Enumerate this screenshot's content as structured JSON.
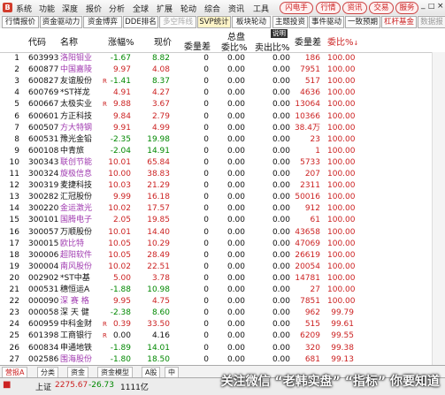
{
  "menubar": {
    "logo": "B",
    "items": [
      "系统",
      "功能",
      "深度",
      "报价",
      "分析",
      "全球",
      "扩展",
      "轮动",
      "综合",
      "资讯",
      "工具"
    ],
    "pills": [
      "闪电手",
      "行情",
      "资讯",
      "交易",
      "服务"
    ],
    "caption_icons": [
      "_",
      "□",
      "×"
    ]
  },
  "tabs": [
    "行情报价",
    "资金驱动力",
    "资金博弈",
    "DDE排名",
    "多空阵线",
    "SVP统计",
    "板块轮动",
    "主题投资",
    "事件驱动",
    "一致预期",
    "杠杆基金",
    "数据报告"
  ],
  "header": {
    "idx": "",
    "code": "代码",
    "name": "名称",
    "pct": "涨幅%",
    "price": "现价",
    "vol": "委量差",
    "total_top": "总盘",
    "ratio": "委比%",
    "sell": "卖出比%",
    "explain": "说明",
    "vol2": "委量差",
    "ratio2": "委比%"
  },
  "rows": [
    {
      "idx": "1",
      "code": "603993",
      "name": "洛阳钼业",
      "mark": "",
      "pct": "-1.67",
      "price": "8.82",
      "vol": "0",
      "ratio": "0.00",
      "sell": "0.00",
      "vol2": "186",
      "ratio2": "100.00",
      "nc": "purple",
      "pc": "green",
      "vc": "red"
    },
    {
      "idx": "2",
      "code": "600877",
      "name": "中国嘉陵",
      "mark": "",
      "pct": "9.97",
      "price": "4.08",
      "vol": "0",
      "ratio": "0.00",
      "sell": "0.00",
      "vol2": "7951",
      "ratio2": "100.00",
      "nc": "purple",
      "pc": "red",
      "vc": "red"
    },
    {
      "idx": "3",
      "code": "600827",
      "name": "友谊股份",
      "mark": "R",
      "pct": "-1.41",
      "price": "8.37",
      "vol": "0",
      "ratio": "0.00",
      "sell": "0.00",
      "vol2": "517",
      "ratio2": "100.00",
      "nc": "dark",
      "pc": "green",
      "vc": "red"
    },
    {
      "idx": "4",
      "code": "600769",
      "name": "*ST祥龙",
      "mark": "",
      "pct": "4.91",
      "price": "4.27",
      "vol": "0",
      "ratio": "0.00",
      "sell": "0.00",
      "vol2": "4636",
      "ratio2": "100.00",
      "nc": "dark",
      "pc": "red",
      "vc": "red"
    },
    {
      "idx": "5",
      "code": "600667",
      "name": "太极实业",
      "mark": "R",
      "pct": "9.88",
      "price": "3.67",
      "vol": "0",
      "ratio": "0.00",
      "sell": "0.00",
      "vol2": "13064",
      "ratio2": "100.00",
      "nc": "dark",
      "pc": "red",
      "vc": "red"
    },
    {
      "idx": "6",
      "code": "600601",
      "name": "方正科技",
      "mark": "",
      "pct": "9.84",
      "price": "2.79",
      "vol": "0",
      "ratio": "0.00",
      "sell": "0.00",
      "vol2": "10366",
      "ratio2": "100.00",
      "nc": "dark",
      "pc": "red",
      "vc": "red"
    },
    {
      "idx": "7",
      "code": "600507",
      "name": "方大特钢",
      "mark": "",
      "pct": "9.91",
      "price": "4.99",
      "vol": "0",
      "ratio": "0.00",
      "sell": "0.00",
      "vol2": "38.4万",
      "ratio2": "100.00",
      "nc": "purple",
      "pc": "red",
      "vc": "red"
    },
    {
      "idx": "8",
      "code": "600531",
      "name": "豫光金铅",
      "mark": "",
      "pct": "-2.35",
      "price": "19.98",
      "vol": "0",
      "ratio": "0.00",
      "sell": "0.00",
      "vol2": "23",
      "ratio2": "100.00",
      "nc": "dark",
      "pc": "green",
      "vc": "red"
    },
    {
      "idx": "9",
      "code": "600108",
      "name": "中青旅",
      "mark": "",
      "pct": "-2.04",
      "price": "14.91",
      "vol": "0",
      "ratio": "0.00",
      "sell": "0.00",
      "vol2": "1",
      "ratio2": "100.00",
      "nc": "dark",
      "pc": "green",
      "vc": "red"
    },
    {
      "idx": "10",
      "code": "300343",
      "name": "联创节能",
      "mark": "",
      "pct": "10.01",
      "price": "65.84",
      "vol": "0",
      "ratio": "0.00",
      "sell": "0.00",
      "vol2": "5733",
      "ratio2": "100.00",
      "nc": "purple",
      "pc": "red",
      "vc": "red"
    },
    {
      "idx": "11",
      "code": "300324",
      "name": "旋极信息",
      "mark": "",
      "pct": "10.00",
      "price": "38.83",
      "vol": "0",
      "ratio": "0.00",
      "sell": "0.00",
      "vol2": "207",
      "ratio2": "100.00",
      "nc": "purple",
      "pc": "red",
      "vc": "red"
    },
    {
      "idx": "12",
      "code": "300319",
      "name": "麦捷科技",
      "mark": "",
      "pct": "10.03",
      "price": "21.29",
      "vol": "0",
      "ratio": "0.00",
      "sell": "0.00",
      "vol2": "2311",
      "ratio2": "100.00",
      "nc": "dark",
      "pc": "red",
      "vc": "red"
    },
    {
      "idx": "13",
      "code": "300282",
      "name": "汇冠股份",
      "mark": "",
      "pct": "9.99",
      "price": "16.18",
      "vol": "0",
      "ratio": "0.00",
      "sell": "0.00",
      "vol2": "50016",
      "ratio2": "100.00",
      "nc": "dark",
      "pc": "red",
      "vc": "red"
    },
    {
      "idx": "14",
      "code": "300220",
      "name": "金运激光",
      "mark": "",
      "pct": "10.02",
      "price": "17.57",
      "vol": "0",
      "ratio": "0.00",
      "sell": "0.00",
      "vol2": "912",
      "ratio2": "100.00",
      "nc": "purple",
      "pc": "red",
      "vc": "red"
    },
    {
      "idx": "15",
      "code": "300101",
      "name": "国腾电子",
      "mark": "",
      "pct": "2.05",
      "price": "19.85",
      "vol": "0",
      "ratio": "0.00",
      "sell": "0.00",
      "vol2": "61",
      "ratio2": "100.00",
      "nc": "purple",
      "pc": "red",
      "vc": "red"
    },
    {
      "idx": "16",
      "code": "300057",
      "name": "万顺股份",
      "mark": "",
      "pct": "10.01",
      "price": "14.40",
      "vol": "0",
      "ratio": "0.00",
      "sell": "0.00",
      "vol2": "43658",
      "ratio2": "100.00",
      "nc": "dark",
      "pc": "red",
      "vc": "red"
    },
    {
      "idx": "17",
      "code": "300015",
      "name": "欧比特",
      "mark": "",
      "pct": "10.05",
      "price": "10.29",
      "vol": "0",
      "ratio": "0.00",
      "sell": "0.00",
      "vol2": "47069",
      "ratio2": "100.00",
      "nc": "purple",
      "pc": "red",
      "vc": "red"
    },
    {
      "idx": "18",
      "code": "300006",
      "name": "超阳软件",
      "mark": "",
      "pct": "10.05",
      "price": "28.49",
      "vol": "0",
      "ratio": "0.00",
      "sell": "0.00",
      "vol2": "26619",
      "ratio2": "100.00",
      "nc": "purple",
      "pc": "red",
      "vc": "red"
    },
    {
      "idx": "19",
      "code": "300004",
      "name": "南风股份",
      "mark": "",
      "pct": "10.02",
      "price": "22.51",
      "vol": "0",
      "ratio": "0.00",
      "sell": "0.00",
      "vol2": "20054",
      "ratio2": "100.00",
      "nc": "purple",
      "pc": "red",
      "vc": "red"
    },
    {
      "idx": "20",
      "code": "002902",
      "name": "*ST中基",
      "mark": "",
      "pct": "5.00",
      "price": "3.78",
      "vol": "0",
      "ratio": "0.00",
      "sell": "0.00",
      "vol2": "14781",
      "ratio2": "100.00",
      "nc": "dark",
      "pc": "red",
      "vc": "red"
    },
    {
      "idx": "21",
      "code": "000531",
      "name": "穗恒运A",
      "mark": "",
      "pct": "-1.88",
      "price": "10.98",
      "vol": "0",
      "ratio": "0.00",
      "sell": "0.00",
      "vol2": "27",
      "ratio2": "100.00",
      "nc": "dark",
      "pc": "green",
      "vc": "red"
    },
    {
      "idx": "22",
      "code": "000090",
      "name": "深 赛 格",
      "mark": "",
      "pct": "9.95",
      "price": "4.75",
      "vol": "0",
      "ratio": "0.00",
      "sell": "0.00",
      "vol2": "7851",
      "ratio2": "100.00",
      "nc": "purple",
      "pc": "red",
      "vc": "red"
    },
    {
      "idx": "23",
      "code": "000058",
      "name": "深 天 健",
      "mark": "",
      "pct": "-2.38",
      "price": "8.60",
      "vol": "0",
      "ratio": "0.00",
      "sell": "0.00",
      "vol2": "962",
      "ratio2": "99.79",
      "nc": "dark",
      "pc": "green",
      "vc": "red"
    },
    {
      "idx": "24",
      "code": "600959",
      "name": "中科金财",
      "mark": "R",
      "pct": "0.39",
      "price": "33.50",
      "vol": "0",
      "ratio": "0.00",
      "sell": "0.00",
      "vol2": "515",
      "ratio2": "99.61",
      "nc": "dark",
      "pc": "red",
      "vc": "red"
    },
    {
      "idx": "25",
      "code": "601398",
      "name": "工商银行",
      "mark": "R",
      "pct": "0.00",
      "price": "4.16",
      "vol": "0",
      "ratio": "0.00",
      "sell": "0.00",
      "vol2": "6209",
      "ratio2": "99.55",
      "nc": "dark",
      "pc": "dark",
      "vc": "red"
    },
    {
      "idx": "26",
      "code": "600834",
      "name": "申通地铁",
      "mark": "",
      "pct": "-1.89",
      "price": "14.01",
      "vol": "0",
      "ratio": "0.00",
      "sell": "0.00",
      "vol2": "320",
      "ratio2": "99.38",
      "nc": "dark",
      "pc": "green",
      "vc": "red"
    },
    {
      "idx": "27",
      "code": "002586",
      "name": "围海股份",
      "mark": "",
      "pct": "-1.80",
      "price": "18.50",
      "vol": "0",
      "ratio": "0.00",
      "sell": "0.00",
      "vol2": "681",
      "ratio2": "99.13",
      "nc": "purple",
      "pc": "green",
      "vc": "red"
    }
  ],
  "bottom_tabs": [
    "营报A",
    "分类",
    "资金",
    "资金模型",
    "A股",
    "中"
  ],
  "status": {
    "logo": "■",
    "market": "上证",
    "index": "2275.67",
    "change": "-26.73",
    "amount": "1111亿",
    "watermark": "关注微信 “老韩实盘” “指标” 你要知道"
  },
  "colors": {
    "up": "#cc2222",
    "down": "#008800",
    "name_special": "#a03ab0",
    "accent": "#d23c2c"
  }
}
